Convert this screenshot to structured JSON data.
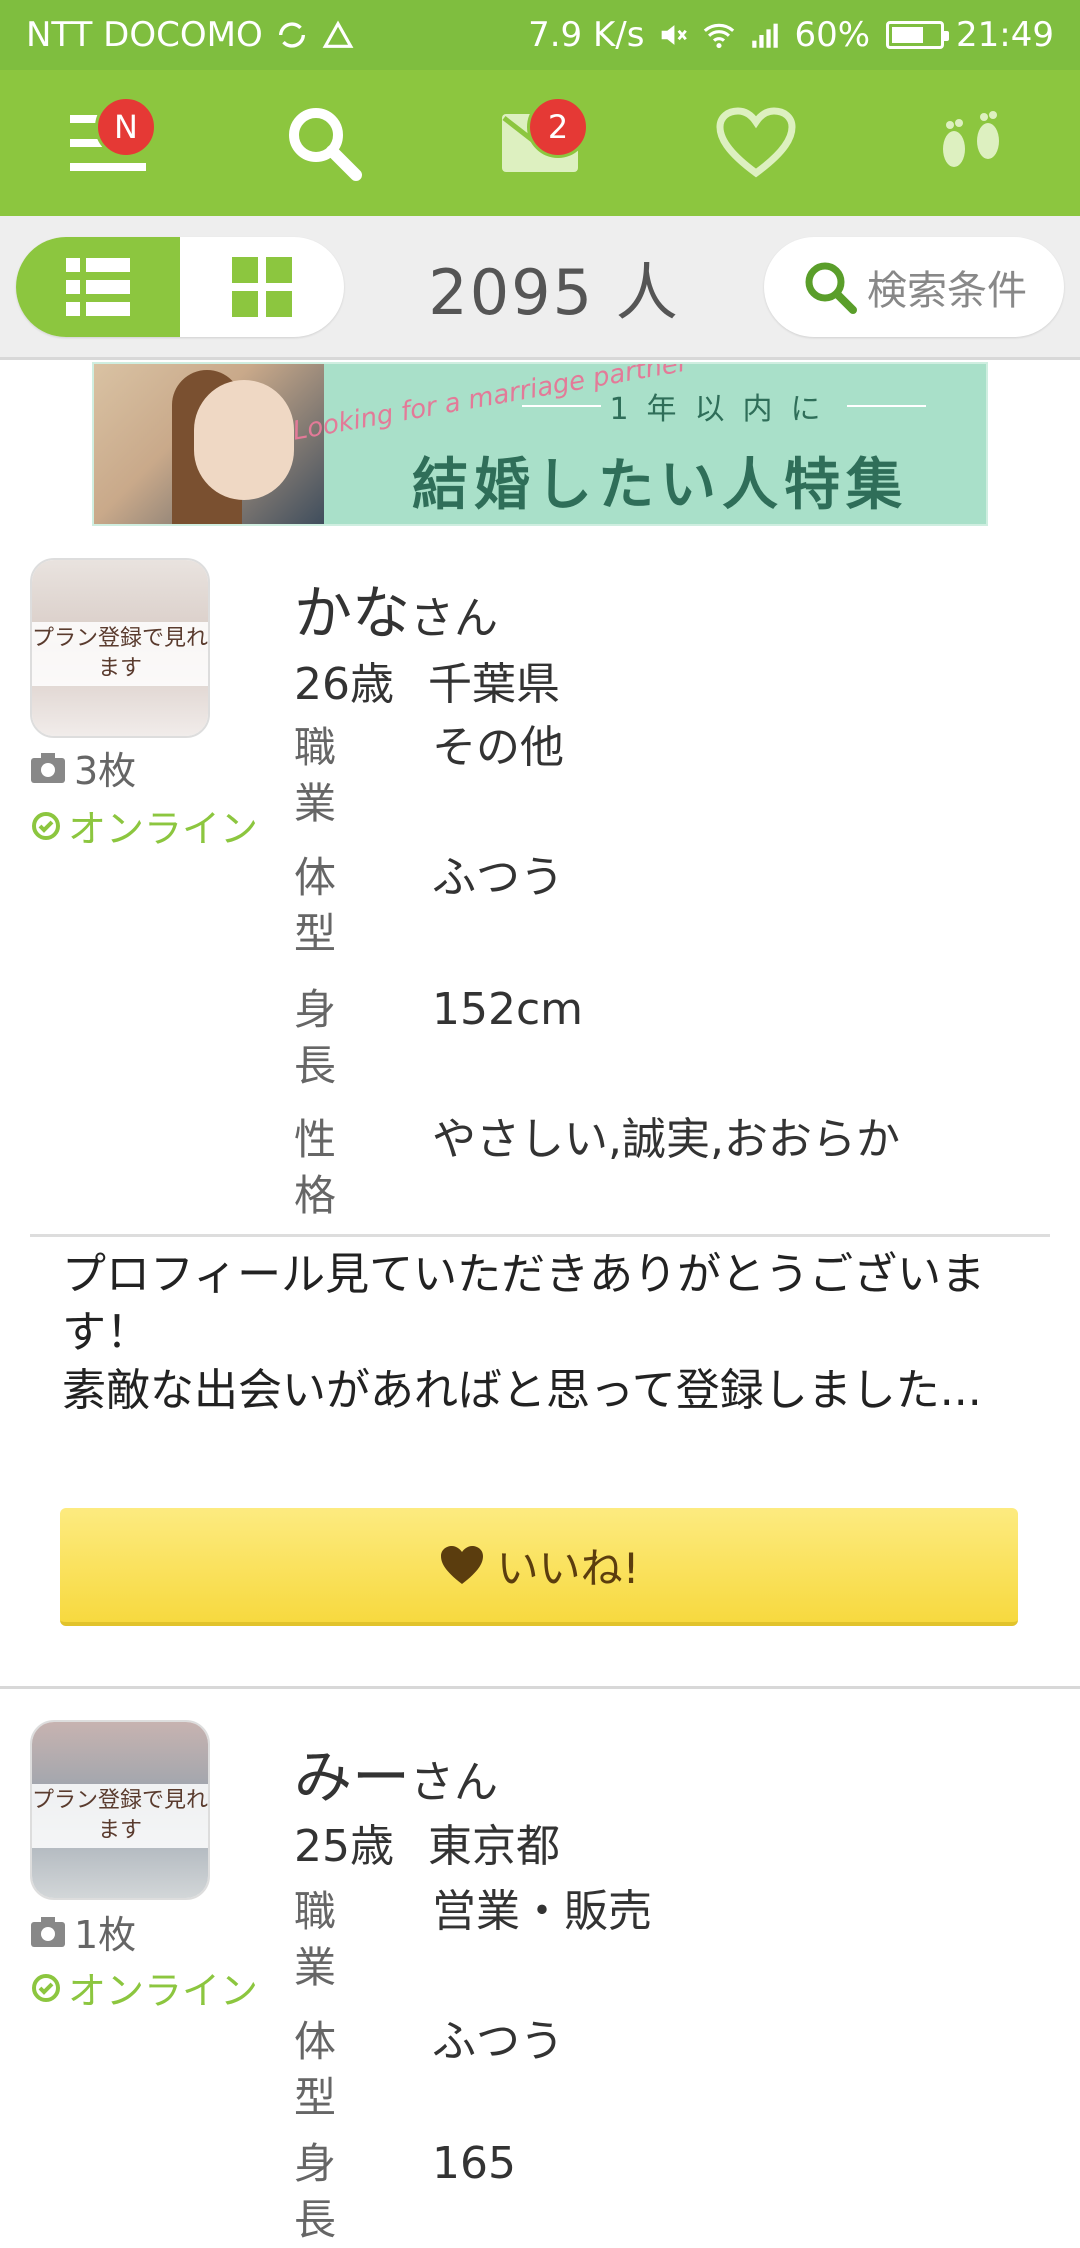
{
  "status_bar": {
    "carrier": "NTT DOCOMO",
    "speed": "7.9 K/s",
    "battery": "60%",
    "time": "21:49"
  },
  "nav": {
    "menu_badge": "N",
    "mail_badge": "2"
  },
  "filter": {
    "count": "2095 人",
    "search_label": "検索条件"
  },
  "banner": {
    "script_text": "Looking for a marriage partner",
    "subtitle": "1年以内に",
    "title": "結婚したい人特集"
  },
  "colors": {
    "brand_green": "#8cc63f",
    "badge_red": "#e53935",
    "like_yellow": "#f7d93f"
  },
  "profiles": [
    {
      "avatar_note": "プラン登録で見れます",
      "photos": "3枚",
      "status": "オンライン",
      "name": "かな",
      "honorific": "さん",
      "age": "26歳",
      "location": "千葉県",
      "job_label": "職業",
      "job": "その他",
      "body_label": "体型",
      "body": "ふつう",
      "height_label": "身長",
      "height": "152cm",
      "personality_label": "性格",
      "personality": "やさしい,誠実,おおらか",
      "message": "プロフィール見ていただきありがとうございます！\n素敵な出会いがあればと思って登録しました...",
      "like_label": "いいね!"
    },
    {
      "avatar_note": "プラン登録で見れます",
      "photos": "1枚",
      "status": "オンライン",
      "name": "みー",
      "honorific": "さん",
      "age": "25歳",
      "location": "東京都",
      "job_label": "職業",
      "job": "営業・販売",
      "body_label": "体型",
      "body": "ふつう",
      "height_label": "身長",
      "height": "165"
    }
  ]
}
